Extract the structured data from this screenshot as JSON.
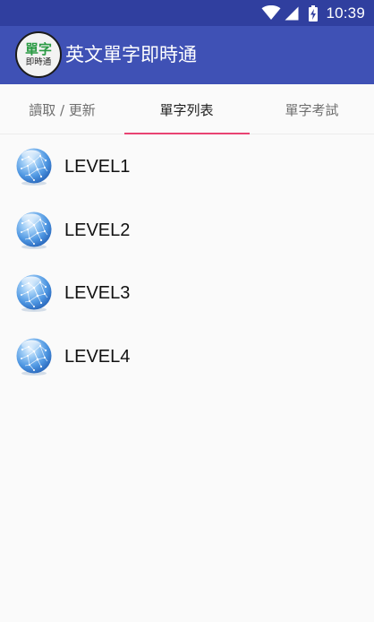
{
  "status_bar": {
    "time": "10:39",
    "icons": [
      "wifi-icon",
      "signal-icon",
      "battery-charging-icon"
    ]
  },
  "app_bar": {
    "logo": {
      "top": "單字",
      "bottom": "即時通"
    },
    "title": "英文單字即時通"
  },
  "tabs": [
    {
      "label": "讀取 / 更新",
      "active": false
    },
    {
      "label": "單字列表",
      "active": true
    },
    {
      "label": "單字考試",
      "active": false
    }
  ],
  "levels": [
    {
      "label": "LEVEL1",
      "icon": "globe-icon"
    },
    {
      "label": "LEVEL2",
      "icon": "globe-icon"
    },
    {
      "label": "LEVEL3",
      "icon": "globe-icon"
    },
    {
      "label": "LEVEL4",
      "icon": "globe-icon"
    }
  ],
  "colors": {
    "status_bar": "#303f9f",
    "app_bar": "#3f51b5",
    "tab_indicator": "#e94373",
    "background": "#fafafa"
  }
}
